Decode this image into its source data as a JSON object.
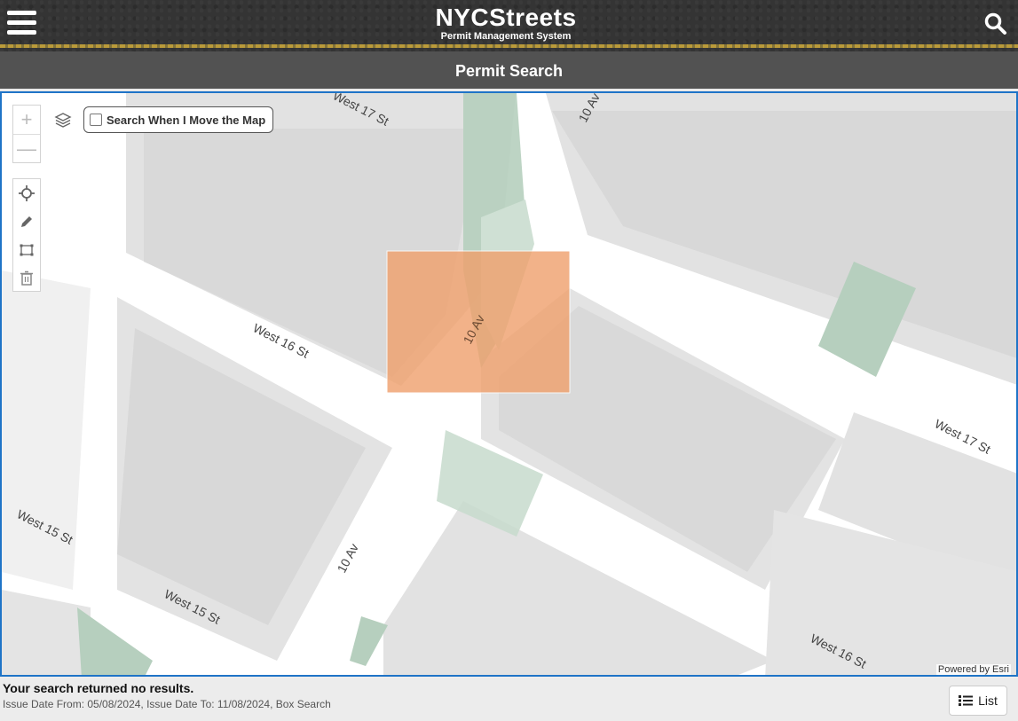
{
  "header": {
    "logo_title": "NYCStreets",
    "logo_subtitle": "Permit Management System",
    "page_title": "Permit Search"
  },
  "map": {
    "move_search_label": "Search When I Move the Map",
    "move_search_checked": false,
    "zoom_in": "+",
    "zoom_out": "—",
    "attribution": "Powered by Esri",
    "street_labels": [
      "West 17 St",
      "10 Av",
      "West 16 St",
      "10 Av",
      "West 17 St",
      "West 15 St",
      "10 Av",
      "West 15 St",
      "West 16 St"
    ],
    "selection_color": "#f0a06c"
  },
  "results": {
    "message": "Your search returned no results.",
    "details": "Issue Date From: 05/08/2024, Issue Date To: 11/08/2024, Box Search",
    "list_button": "List"
  },
  "colors": {
    "accent": "#1f74c7",
    "header": "#343434",
    "titlebar": "#525252",
    "park": "#b6cfbe"
  }
}
